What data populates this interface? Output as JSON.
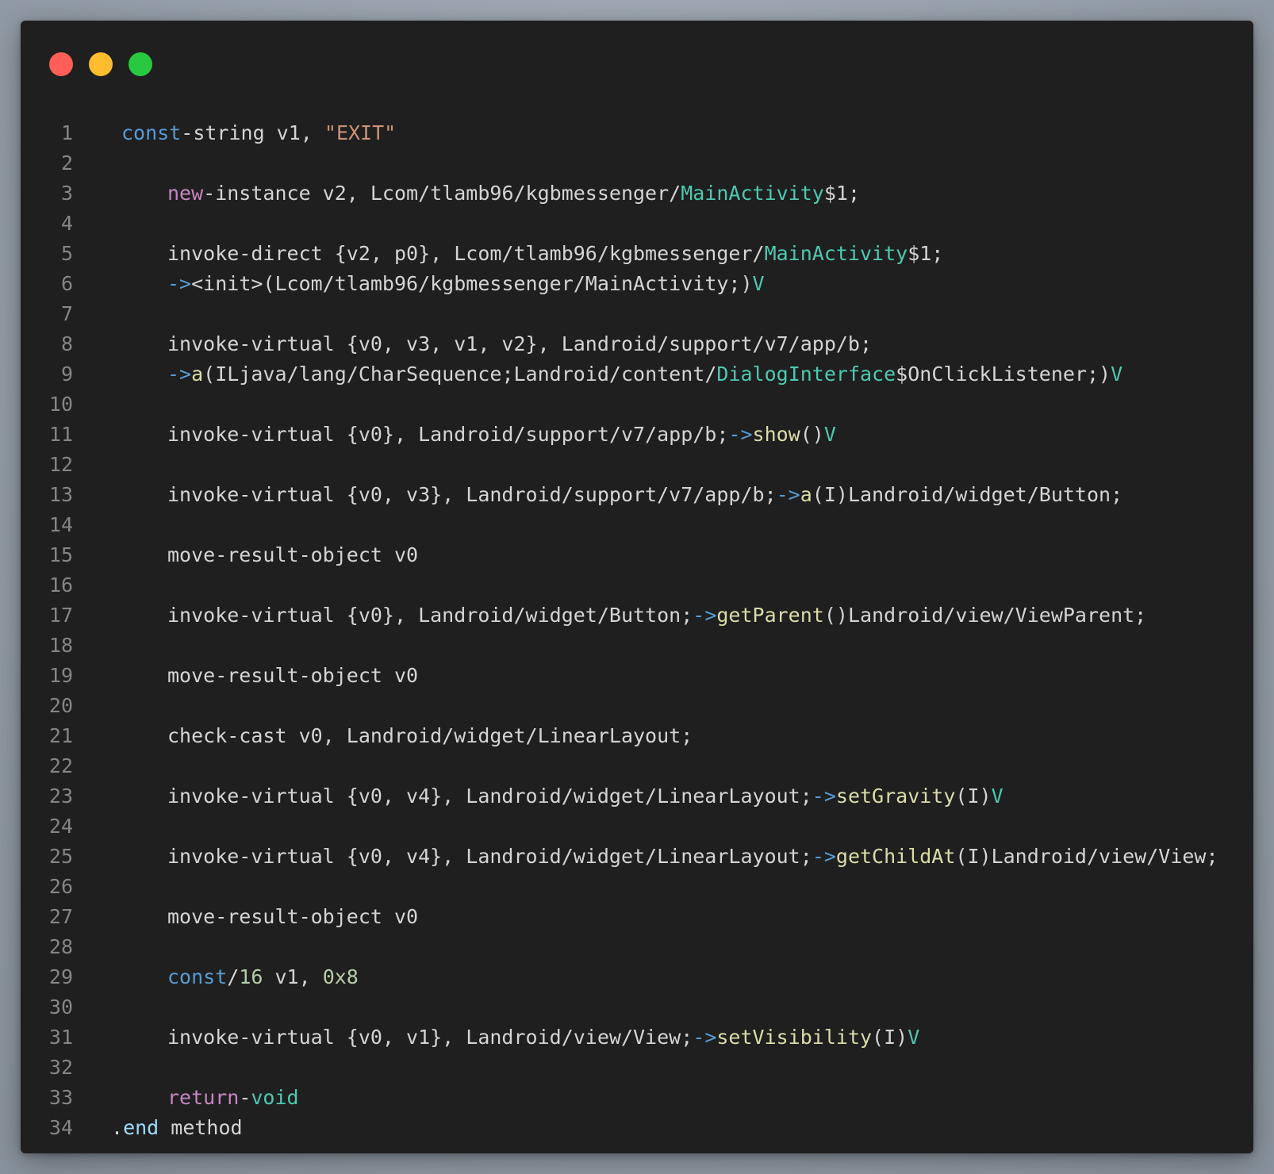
{
  "window": {
    "controls": [
      {
        "name": "close",
        "color": "#ff5f57"
      },
      {
        "name": "minimize",
        "color": "#febc2e"
      },
      {
        "name": "maximize",
        "color": "#28c840"
      }
    ]
  },
  "code": {
    "lines": [
      {
        "n": "1",
        "indent": 1,
        "tokens": [
          {
            "t": "const",
            "s": "keyword"
          },
          {
            "t": "-string v1, ",
            "s": "default"
          },
          {
            "t": "\"EXIT\"",
            "s": "string"
          }
        ]
      },
      {
        "n": "2",
        "indent": 0,
        "tokens": []
      },
      {
        "n": "3",
        "indent": 4,
        "tokens": [
          {
            "t": "new",
            "s": "control"
          },
          {
            "t": "-instance v2, Lcom/tlamb96/kgbmessenger/",
            "s": "default"
          },
          {
            "t": "MainActivity",
            "s": "type"
          },
          {
            "t": "$1;",
            "s": "default"
          }
        ]
      },
      {
        "n": "4",
        "indent": 0,
        "tokens": []
      },
      {
        "n": "5",
        "indent": 4,
        "tokens": [
          {
            "t": "invoke-direct {v2, p0}, Lcom/tlamb96/kgbmessenger/",
            "s": "default"
          },
          {
            "t": "MainActivity",
            "s": "type"
          },
          {
            "t": "$1;",
            "s": "default"
          }
        ]
      },
      {
        "n": "6",
        "indent": 4,
        "tokens": [
          {
            "t": "->",
            "s": "keyword"
          },
          {
            "t": "<init>(Lcom/tlamb96/kgbmessenger/MainActivity;)",
            "s": "default"
          },
          {
            "t": "V",
            "s": "type"
          }
        ]
      },
      {
        "n": "7",
        "indent": 0,
        "tokens": []
      },
      {
        "n": "8",
        "indent": 4,
        "tokens": [
          {
            "t": "invoke-virtual {v0, v3, v1, v2}, Landroid/support/v7/app/b;",
            "s": "default"
          }
        ]
      },
      {
        "n": "9",
        "indent": 4,
        "tokens": [
          {
            "t": "->",
            "s": "keyword"
          },
          {
            "t": "a",
            "s": "func"
          },
          {
            "t": "(ILjava/lang/CharSequence;Landroid/content/",
            "s": "default"
          },
          {
            "t": "DialogInterface",
            "s": "type"
          },
          {
            "t": "$OnClickListener;)",
            "s": "default"
          },
          {
            "t": "V",
            "s": "type"
          }
        ]
      },
      {
        "n": "10",
        "indent": 0,
        "tokens": []
      },
      {
        "n": "11",
        "indent": 4,
        "tokens": [
          {
            "t": "invoke-virtual {v0}, Landroid/support/v7/app/b;",
            "s": "default"
          },
          {
            "t": "->",
            "s": "keyword"
          },
          {
            "t": "show",
            "s": "func"
          },
          {
            "t": "()",
            "s": "default"
          },
          {
            "t": "V",
            "s": "type"
          }
        ]
      },
      {
        "n": "12",
        "indent": 0,
        "tokens": []
      },
      {
        "n": "13",
        "indent": 4,
        "tokens": [
          {
            "t": "invoke-virtual {v0, v3}, Landroid/support/v7/app/b;",
            "s": "default"
          },
          {
            "t": "->",
            "s": "keyword"
          },
          {
            "t": "a",
            "s": "func"
          },
          {
            "t": "(I)Landroid/widget/Button;",
            "s": "default"
          }
        ]
      },
      {
        "n": "14",
        "indent": 0,
        "tokens": []
      },
      {
        "n": "15",
        "indent": 4,
        "tokens": [
          {
            "t": "move-result-object v0",
            "s": "default"
          }
        ]
      },
      {
        "n": "16",
        "indent": 0,
        "tokens": []
      },
      {
        "n": "17",
        "indent": 4,
        "tokens": [
          {
            "t": "invoke-virtual {v0}, Landroid/widget/Button;",
            "s": "default"
          },
          {
            "t": "->",
            "s": "keyword"
          },
          {
            "t": "getParent",
            "s": "func"
          },
          {
            "t": "()Landroid/view/ViewParent;",
            "s": "default"
          }
        ]
      },
      {
        "n": "18",
        "indent": 0,
        "tokens": []
      },
      {
        "n": "19",
        "indent": 4,
        "tokens": [
          {
            "t": "move-result-object v0",
            "s": "default"
          }
        ]
      },
      {
        "n": "20",
        "indent": 0,
        "tokens": []
      },
      {
        "n": "21",
        "indent": 4,
        "tokens": [
          {
            "t": "check-cast v0, Landroid/widget/LinearLayout;",
            "s": "default"
          }
        ]
      },
      {
        "n": "22",
        "indent": 0,
        "tokens": []
      },
      {
        "n": "23",
        "indent": 4,
        "tokens": [
          {
            "t": "invoke-virtual {v0, v4}, Landroid/widget/LinearLayout;",
            "s": "default"
          },
          {
            "t": "->",
            "s": "keyword"
          },
          {
            "t": "setGravity",
            "s": "func"
          },
          {
            "t": "(I)",
            "s": "default"
          },
          {
            "t": "V",
            "s": "type"
          }
        ]
      },
      {
        "n": "24",
        "indent": 0,
        "tokens": []
      },
      {
        "n": "25",
        "indent": 4,
        "tokens": [
          {
            "t": "invoke-virtual {v0, v4}, Landroid/widget/LinearLayout;",
            "s": "default"
          },
          {
            "t": "->",
            "s": "keyword"
          },
          {
            "t": "getChildAt",
            "s": "func"
          },
          {
            "t": "(I)Landroid/view/View;",
            "s": "default"
          }
        ]
      },
      {
        "n": "26",
        "indent": 0,
        "tokens": []
      },
      {
        "n": "27",
        "indent": 4,
        "tokens": [
          {
            "t": "move-result-object v0",
            "s": "default"
          }
        ]
      },
      {
        "n": "28",
        "indent": 0,
        "tokens": []
      },
      {
        "n": "29",
        "indent": 4,
        "tokens": [
          {
            "t": "const",
            "s": "keyword"
          },
          {
            "t": "/",
            "s": "default"
          },
          {
            "t": "16",
            "s": "number"
          },
          {
            "t": " v1, ",
            "s": "default"
          },
          {
            "t": "0x8",
            "s": "number"
          }
        ]
      },
      {
        "n": "30",
        "indent": 0,
        "tokens": []
      },
      {
        "n": "31",
        "indent": 4,
        "tokens": [
          {
            "t": "invoke-virtual {v0, v1}, Landroid/view/View;",
            "s": "default"
          },
          {
            "t": "->",
            "s": "keyword"
          },
          {
            "t": "setVisibility",
            "s": "func"
          },
          {
            "t": "(I)",
            "s": "default"
          },
          {
            "t": "V",
            "s": "type"
          }
        ]
      },
      {
        "n": "32",
        "indent": 0,
        "tokens": []
      },
      {
        "n": "33",
        "indent": 4,
        "tokens": [
          {
            "t": "return",
            "s": "control"
          },
          {
            "t": "-",
            "s": "default"
          },
          {
            "t": "void",
            "s": "type"
          }
        ]
      },
      {
        "n": "34",
        "indent": 0,
        "tokens": [
          {
            "t": ".",
            "s": "default"
          },
          {
            "t": "end",
            "s": "var"
          },
          {
            "t": " method",
            "s": "default"
          }
        ]
      }
    ]
  }
}
